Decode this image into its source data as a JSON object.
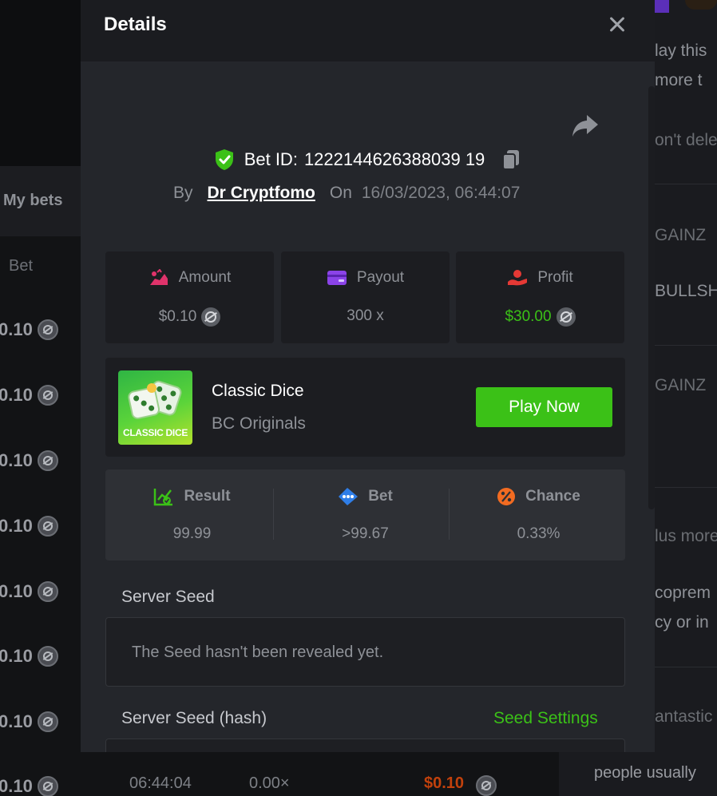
{
  "modal": {
    "title": "Details",
    "bet_id_label": "Bet ID:",
    "bet_id": "1222144626388039 19",
    "by_label": "By",
    "username": "Dr Cryptfomo",
    "on_label": "On",
    "datetime": "16/03/2023, 06:44:07"
  },
  "stats": {
    "amount_label": "Amount",
    "amount_value": "$0.10",
    "payout_label": "Payout",
    "payout_value": "300 x",
    "profit_label": "Profit",
    "profit_value": "$30.00"
  },
  "game": {
    "name": "Classic Dice",
    "provider": "BC Originals",
    "thumb_label": "CLASSIC DICE",
    "play_label": "Play Now"
  },
  "result": {
    "result_label": "Result",
    "result_value": "99.99",
    "bet_label": "Bet",
    "bet_value": ">99.67",
    "chance_label": "Chance",
    "chance_value": "0.33%"
  },
  "seed": {
    "server_seed_label": "Server Seed",
    "server_seed_text": "The Seed hasn't been revealed yet.",
    "server_seed_hash_label": "Server Seed (hash)",
    "seed_settings_label": "Seed Settings"
  },
  "background": {
    "my_bets": "My bets",
    "bet_header": "Bet",
    "row_amount": "0.10",
    "right_texts": [
      "lay this",
      "more t",
      "on't dele",
      "GAINZ",
      "BULLSH",
      "GAINZ",
      "lus more",
      "coprem",
      "cy or in",
      "antastic"
    ],
    "bottom_time": "06:44:04",
    "bottom_mult": "0.00×",
    "bottom_amount": "$0.10",
    "bottom_right": "people usually"
  },
  "colors": {
    "accent_green": "#3bc117",
    "modal_bg": "#24262b",
    "header_bg": "#1b1c20"
  }
}
